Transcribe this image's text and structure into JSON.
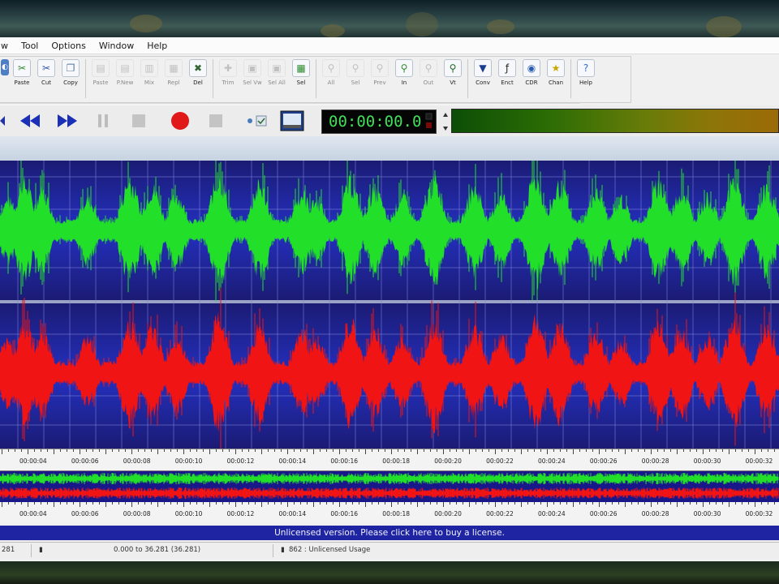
{
  "menu": [
    "Tool",
    "Options",
    "Window",
    "Help"
  ],
  "toolbar_main": [
    {
      "label": "Paste",
      "icon": "paste-icon",
      "color": "#2e8b2e",
      "enabled": true
    },
    {
      "label": "Cut",
      "icon": "cut-icon",
      "color": "#3355aa",
      "enabled": true
    },
    {
      "label": "Copy",
      "icon": "copy-icon",
      "color": "#557799",
      "enabled": true
    },
    {
      "label": "Paste",
      "icon": "paste-new-icon",
      "color": "#888888",
      "enabled": false
    },
    {
      "label": "P.New",
      "icon": "paste-new-file-icon",
      "color": "#888888",
      "enabled": false
    },
    {
      "label": "Mix",
      "icon": "mix-icon",
      "color": "#888888",
      "enabled": false
    },
    {
      "label": "Repl",
      "icon": "replace-icon",
      "color": "#888888",
      "enabled": false
    },
    {
      "label": "Del",
      "icon": "delete-icon",
      "color": "#336633",
      "enabled": true
    },
    {
      "label": "Trim",
      "icon": "trim-icon",
      "color": "#888888",
      "enabled": false
    },
    {
      "label": "Sel Vw",
      "icon": "select-view-icon",
      "color": "#888888",
      "enabled": false
    },
    {
      "label": "Sel All",
      "icon": "select-all-icon",
      "color": "#888888",
      "enabled": false
    },
    {
      "label": "Sel",
      "icon": "select-icon",
      "color": "#2e8b2e",
      "enabled": true
    },
    {
      "label": "All",
      "icon": "zoom-all-icon",
      "color": "#888888",
      "enabled": false
    },
    {
      "label": "Sel",
      "icon": "zoom-sel-icon",
      "color": "#888888",
      "enabled": false
    },
    {
      "label": "Prev",
      "icon": "zoom-prev-icon",
      "color": "#888888",
      "enabled": false
    },
    {
      "label": "In",
      "icon": "zoom-in-icon",
      "color": "#2e8b2e",
      "enabled": true
    },
    {
      "label": "Out",
      "icon": "zoom-out-icon",
      "color": "#888888",
      "enabled": false
    },
    {
      "label": "Vt",
      "icon": "zoom-vertical-icon",
      "color": "#226622",
      "enabled": true
    },
    {
      "label": "Conv",
      "icon": "convert-icon",
      "color": "#1a3d8f",
      "enabled": true
    },
    {
      "label": "Enct",
      "icon": "encode-icon",
      "color": "#222222",
      "enabled": true
    },
    {
      "label": "CDR",
      "icon": "cd-rip-icon",
      "color": "#2a5db0",
      "enabled": true
    },
    {
      "label": "Chan",
      "icon": "channels-icon",
      "color": "#c9a800",
      "enabled": true
    },
    {
      "label": "Help",
      "icon": "help-icon",
      "color": "#2f6fd0",
      "enabled": true
    }
  ],
  "transport": {
    "time": "00:00:00.0"
  },
  "timeline_labels": [
    "00:00:04",
    "00:00:06",
    "00:00:08",
    "00:00:10",
    "00:00:12",
    "00:00:14",
    "00:00:16",
    "00:00:18",
    "00:00:20",
    "00:00:22",
    "00:00:24",
    "00:00:26",
    "00:00:28",
    "00:00:30",
    "00:00:32"
  ],
  "timeline2_labels": [
    "00:00:04",
    "00:00:06",
    "00:00:08",
    "00:00:10",
    "00:00:12",
    "00:00:14",
    "00:00:16",
    "00:00:18",
    "00:00:20",
    "00:00:22",
    "00:00:24",
    "00:00:26",
    "00:00:28",
    "00:00:30",
    "00:00:32"
  ],
  "license_text": "Unlicensed version. Please click here to buy a license.",
  "status": {
    "cell1": "281",
    "cell2": "0.000 to 36.281 (36.281)",
    "cell3": "862 : Unlicensed Usage"
  },
  "colors": {
    "wave_bg": "#1a1a7a",
    "left_channel": "#22e02a",
    "right_channel": "#f01414",
    "license_bar": "#1f24a3",
    "time_text": "#3fe05a"
  }
}
